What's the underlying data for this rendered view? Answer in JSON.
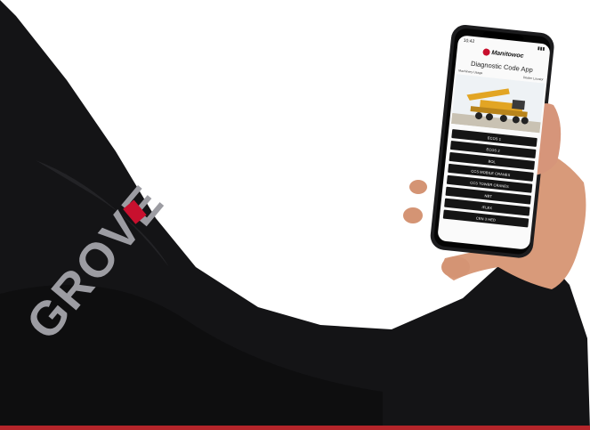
{
  "phone": {
    "status_time": "10:42",
    "brand": "Manitowoc",
    "app_title": "Diagnostic Code App",
    "left_link": "Machinery Usage",
    "right_link": "Dealer Locator",
    "menu_items": [
      "ECOS 1",
      "ECOS 2",
      "BOL",
      "CCS MOBILE CRANES",
      "CCS TOWER CRANES",
      "NBT",
      "IFLEX",
      "CEN 3 HED"
    ]
  },
  "jacket_logo_text": "GROVE",
  "colors": {
    "jacket": "#141416",
    "skin": "#d89a7a",
    "brand_red": "#c8102e",
    "crane_yellow": "#e2a524",
    "bottom_line": "#b5252a"
  }
}
